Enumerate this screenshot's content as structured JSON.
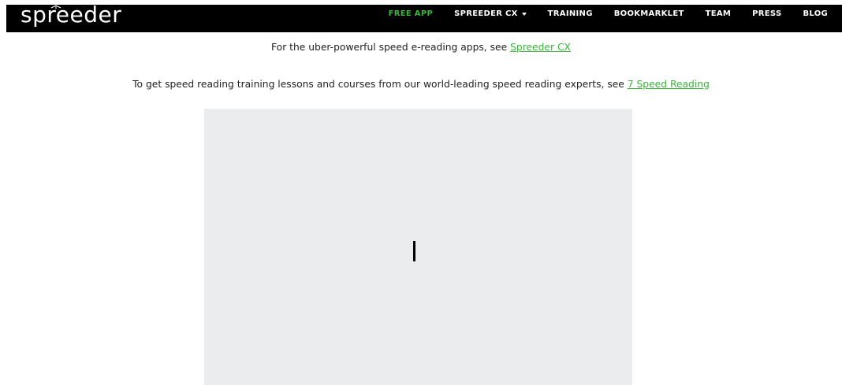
{
  "navbar": {
    "logo_text": "spreeder",
    "items": [
      {
        "label": "FREE APP",
        "active": true
      },
      {
        "label": "SPREEDER CX",
        "dropdown": true
      },
      {
        "label": "TRAINING"
      },
      {
        "label": "BOOKMARKLET"
      },
      {
        "label": "TEAM"
      },
      {
        "label": "PRESS"
      },
      {
        "label": "BLOG"
      }
    ]
  },
  "info": {
    "line1_text": "For the uber-powerful speed e-reading apps, see ",
    "line1_link": "Spreeder CX",
    "line2_text": "To get speed reading training lessons and courses from our world-leading speed reading experts, see ",
    "line2_link": "7 Speed Reading"
  },
  "colors": {
    "accent": "#3bb53b",
    "navbar_bg": "#000000",
    "reader_bg": "#eaeced"
  }
}
